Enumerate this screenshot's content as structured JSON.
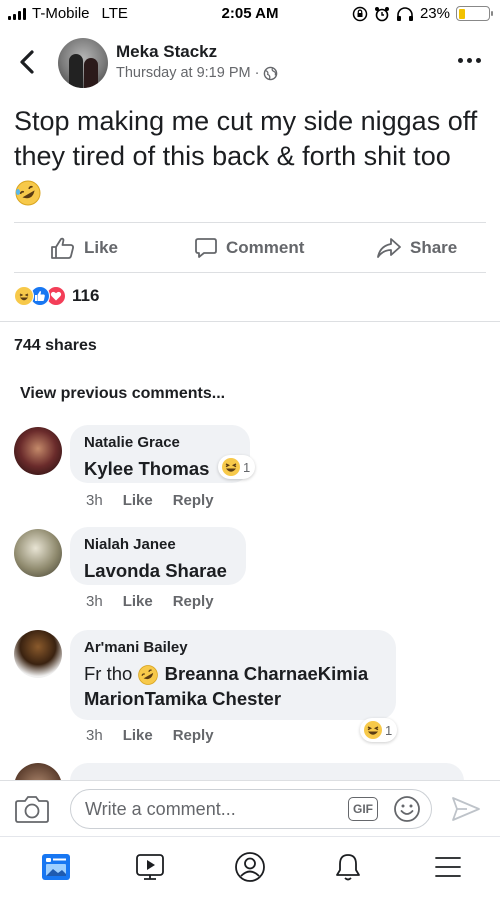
{
  "status_bar": {
    "carrier": "T-Mobile",
    "network": "LTE",
    "time": "2:05 AM",
    "battery_percent": "23%",
    "battery_level": 0.23
  },
  "post": {
    "author": "Meka Stackz",
    "timestamp": "Thursday at 9:19 PM",
    "separator": "·",
    "privacy_icon": "globe-icon",
    "text": "Stop making me cut my side niggas off they tired of this back & forth shit too",
    "text_emoji": "rolling-on-floor-laughing-emoji"
  },
  "actions": {
    "like": "Like",
    "comment": "Comment",
    "share": "Share"
  },
  "reactions": {
    "types": [
      "haha",
      "like",
      "love"
    ],
    "count": "116"
  },
  "shares": "744 shares",
  "view_previous": "View previous comments...",
  "comments": [
    {
      "author": "Natalie Grace",
      "body_tag": "Kylee Thomas",
      "time": "3h",
      "like": "Like",
      "reply": "Reply",
      "reaction": "haha",
      "reaction_count": "1"
    },
    {
      "author": "Nialah Janee",
      "body_tag": "Lavonda Sharae",
      "time": "3h",
      "like": "Like",
      "reply": "Reply"
    },
    {
      "author": "Ar'mani Bailey",
      "body_prefix": "Fr tho",
      "body_tag_line1": "Breanna CharnaeKimia",
      "body_tag_line2": "MarionTamika Chester",
      "time": "3h",
      "like": "Like",
      "reply": "Reply",
      "reaction": "haha",
      "reaction_count": "1"
    }
  ],
  "composer": {
    "placeholder": "Write a comment...",
    "gif_label": "GIF"
  },
  "tabs": [
    "news-feed",
    "watch",
    "profile",
    "notifications",
    "menu"
  ],
  "colors": {
    "brand_blue": "#1877f2",
    "text_secondary": "#65676b",
    "bubble_bg": "#f0f2f5",
    "love_red": "#f33e58",
    "haha_yellow": "#f7c94a"
  }
}
